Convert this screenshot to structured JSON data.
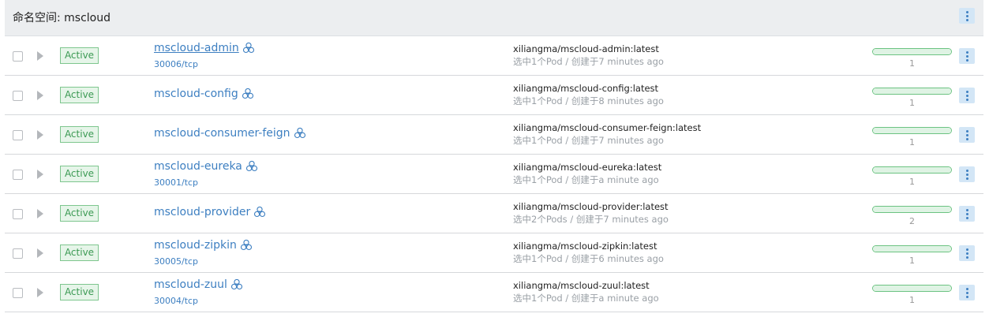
{
  "namespace": {
    "label": "命名空间: mscloud"
  },
  "colors": {
    "link": "#3d7fc1",
    "active_green": "#3c9a54",
    "kebab_bg": "#d3e6f6"
  },
  "rows": [
    {
      "status": "Active",
      "name": "mscloud-admin",
      "port": "30006/tcp",
      "image": "xiliangma/mscloud-admin:latest",
      "detail": "选中1个Pod / 创建于7 minutes ago",
      "pods": "1",
      "health": 1.0
    },
    {
      "status": "Active",
      "name": "mscloud-config",
      "port": "",
      "image": "xiliangma/mscloud-config:latest",
      "detail": "选中1个Pod / 创建于8 minutes ago",
      "pods": "1",
      "health": 1.0
    },
    {
      "status": "Active",
      "name": "mscloud-consumer-feign",
      "port": "",
      "image": "xiliangma/mscloud-consumer-feign:latest",
      "detail": "选中1个Pod / 创建于7 minutes ago",
      "pods": "1",
      "health": 1.0
    },
    {
      "status": "Active",
      "name": "mscloud-eureka",
      "port": "30001/tcp",
      "image": "xiliangma/mscloud-eureka:latest",
      "detail": "选中1个Pod / 创建于a minute ago",
      "pods": "1",
      "health": 1.0
    },
    {
      "status": "Active",
      "name": "mscloud-provider",
      "port": "",
      "image": "xiliangma/mscloud-provider:latest",
      "detail": "选中2个Pods / 创建于7 minutes ago",
      "pods": "2",
      "health": 1.0
    },
    {
      "status": "Active",
      "name": "mscloud-zipkin",
      "port": "30005/tcp",
      "image": "xiliangma/mscloud-zipkin:latest",
      "detail": "选中1个Pod / 创建于6 minutes ago",
      "pods": "1",
      "health": 1.0
    },
    {
      "status": "Active",
      "name": "mscloud-zuul",
      "port": "30004/tcp",
      "image": "xiliangma/mscloud-zuul:latest",
      "detail": "选中1个Pod / 创建于a minute ago",
      "pods": "1",
      "health": 1.0
    }
  ]
}
